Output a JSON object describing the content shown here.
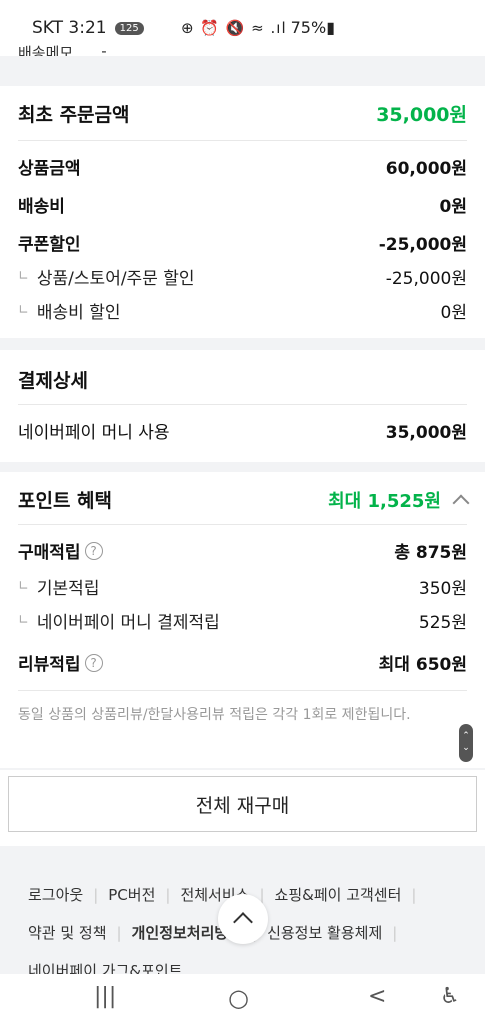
{
  "status_bar": {
    "carrier_time": "SKT 3:21",
    "badge": "125",
    "icons": "⊕ ⏰ 🔇 ≈ .ıl",
    "battery": "75%▮"
  },
  "clipped_row": {
    "label": "배송메모",
    "value": "-"
  },
  "order_summary": {
    "title": "최초 주문금액",
    "total": "35,000원",
    "lines": [
      {
        "label": "상품금액",
        "value": "60,000원"
      },
      {
        "label": "배송비",
        "value": "0원"
      },
      {
        "label": "쿠폰할인",
        "value": "-25,000원"
      }
    ],
    "sub_lines": [
      {
        "label": "상품/스토어/주문 할인",
        "value": "-25,000원"
      },
      {
        "label": "배송비 할인",
        "value": "0원"
      }
    ]
  },
  "payment_detail": {
    "title": "결제상세",
    "line": {
      "label": "네이버페이 머니 사용",
      "value": "35,000원"
    }
  },
  "points": {
    "title": "포인트 혜택",
    "max": "최대 1,525원",
    "purchase": {
      "label": "구매적립",
      "value": "총 875원"
    },
    "sub_lines": [
      {
        "label": "기본적립",
        "value": "350원"
      },
      {
        "label": "네이버페이 머니 결제적립",
        "value": "525원"
      }
    ],
    "review": {
      "label": "리뷰적립",
      "value": "최대 650원"
    },
    "notice": "동일 상품의 상품리뷰/한달사용리뷰 적립은 각각 1회로 제한됩니다."
  },
  "rebuy_button": "전체 재구매",
  "footer": {
    "row1": [
      "로그아웃",
      "PC버전",
      "전체서비스",
      "쇼핑&페이 고객센터"
    ],
    "row2": [
      "약관 및 정책",
      "개인정보처리방침",
      "신용정보 활용체제"
    ],
    "row3": "네이버페이 가그&포인트"
  },
  "nav": {
    "recent": "|||",
    "home": "○",
    "back": "<",
    "access": "♿"
  }
}
